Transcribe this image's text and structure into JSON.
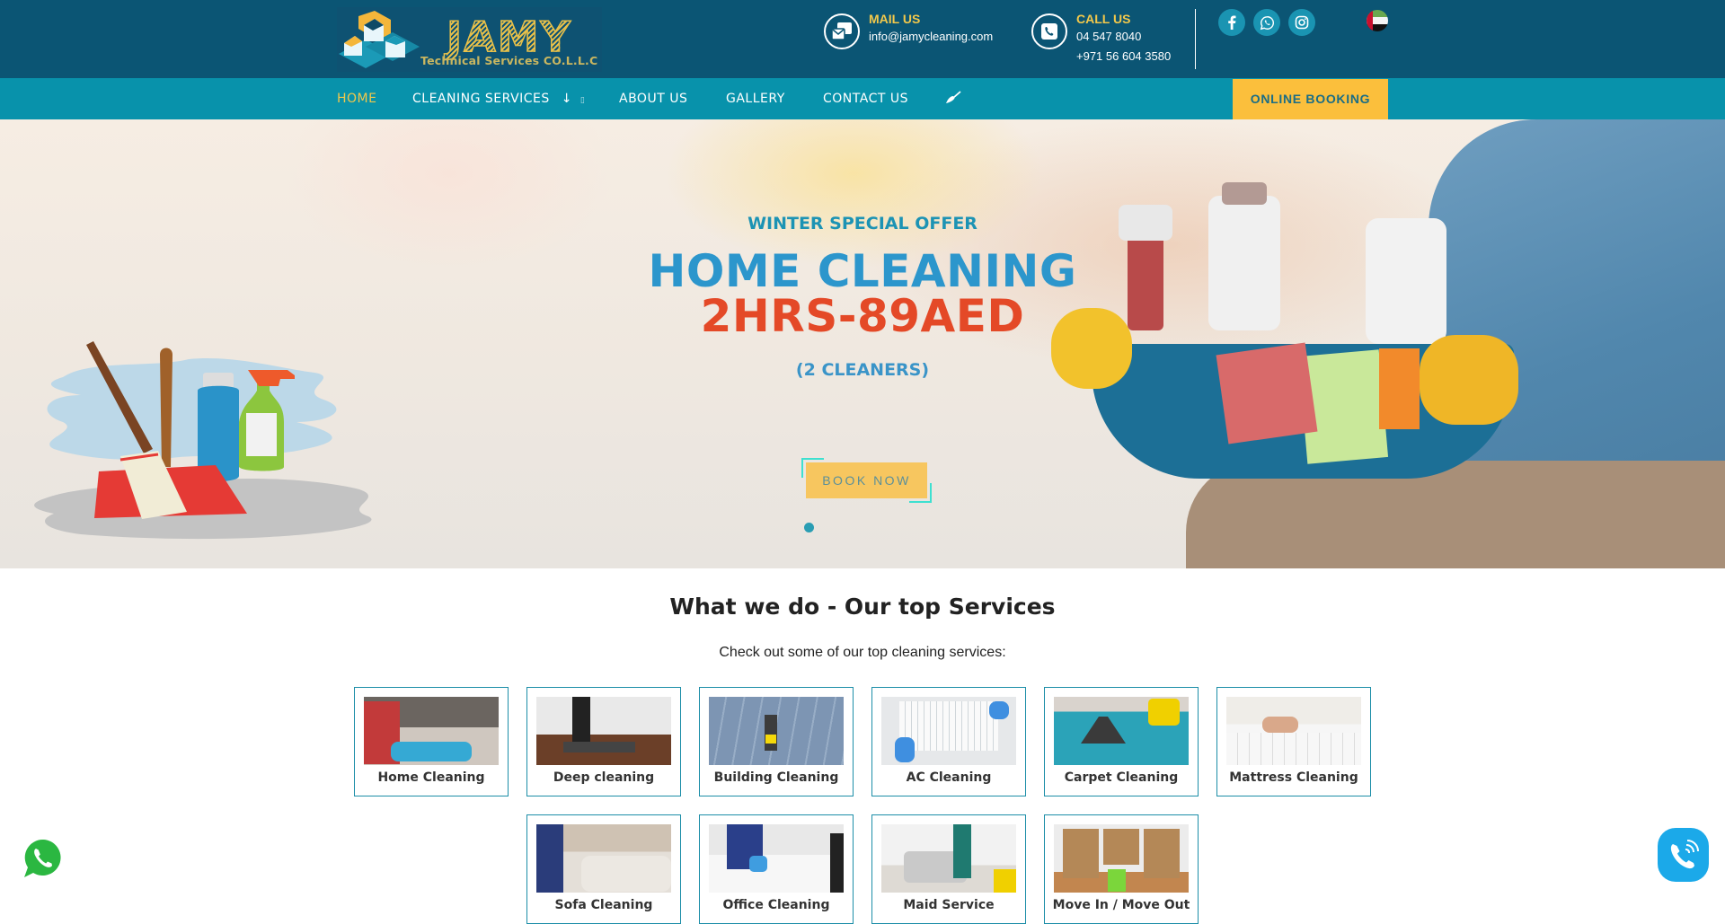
{
  "brand": {
    "name": "JAMY",
    "subtitle": "Technical Services CO.L.L.C"
  },
  "header": {
    "mail": {
      "title": "MAIL US",
      "email": "info@jamycleaning.com",
      "icon": "mail-icon"
    },
    "call": {
      "title": "CALL US",
      "phone1": "04 547 8040",
      "phone2": "+971 56 604 3580",
      "icon": "phone-icon"
    },
    "social": [
      {
        "name": "facebook",
        "icon": "facebook-icon"
      },
      {
        "name": "whatsapp",
        "icon": "whatsapp-icon"
      },
      {
        "name": "instagram",
        "icon": "instagram-icon"
      }
    ],
    "language_flag": "uae-flag-icon"
  },
  "nav": {
    "items": [
      {
        "label": "HOME",
        "active": true
      },
      {
        "label": "CLEANING SERVICES",
        "dropdown_arrow": "↓",
        "extra_glyph": "▯"
      },
      {
        "label": "ABOUT US"
      },
      {
        "label": "GALLERY"
      },
      {
        "label": "CONTACT US"
      }
    ],
    "extra_icon": "broom-icon",
    "cta": "ONLINE BOOKING"
  },
  "hero": {
    "offer": "WINTER SPECIAL OFFER",
    "headline": "HOME CLEANING",
    "price": "2HRS-89AED",
    "note": "(2 CLEANERS)",
    "button": "BOOK NOW",
    "slides_total": 1,
    "slide_active": 1
  },
  "services": {
    "title": "What we do - Our top Services",
    "subtitle": "Check out some of our top cleaning services:",
    "row1": [
      {
        "label": "Home Cleaning"
      },
      {
        "label": "Deep cleaning"
      },
      {
        "label": "Building Cleaning"
      },
      {
        "label": "AC Cleaning"
      },
      {
        "label": "Carpet Cleaning"
      },
      {
        "label": "Mattress Cleaning"
      }
    ],
    "row2": [
      {
        "label": "Sofa Cleaning"
      },
      {
        "label": "Office Cleaning"
      },
      {
        "label": "Maid Service"
      },
      {
        "label": "Move In / Move Out"
      }
    ]
  },
  "colors": {
    "topbar": "#0b5574",
    "navbar": "#0892ab",
    "accent_yellow": "#fbbf3c",
    "headline_blue": "#2c96cc",
    "price_red": "#e44927",
    "card_border": "#1c8ea8"
  }
}
